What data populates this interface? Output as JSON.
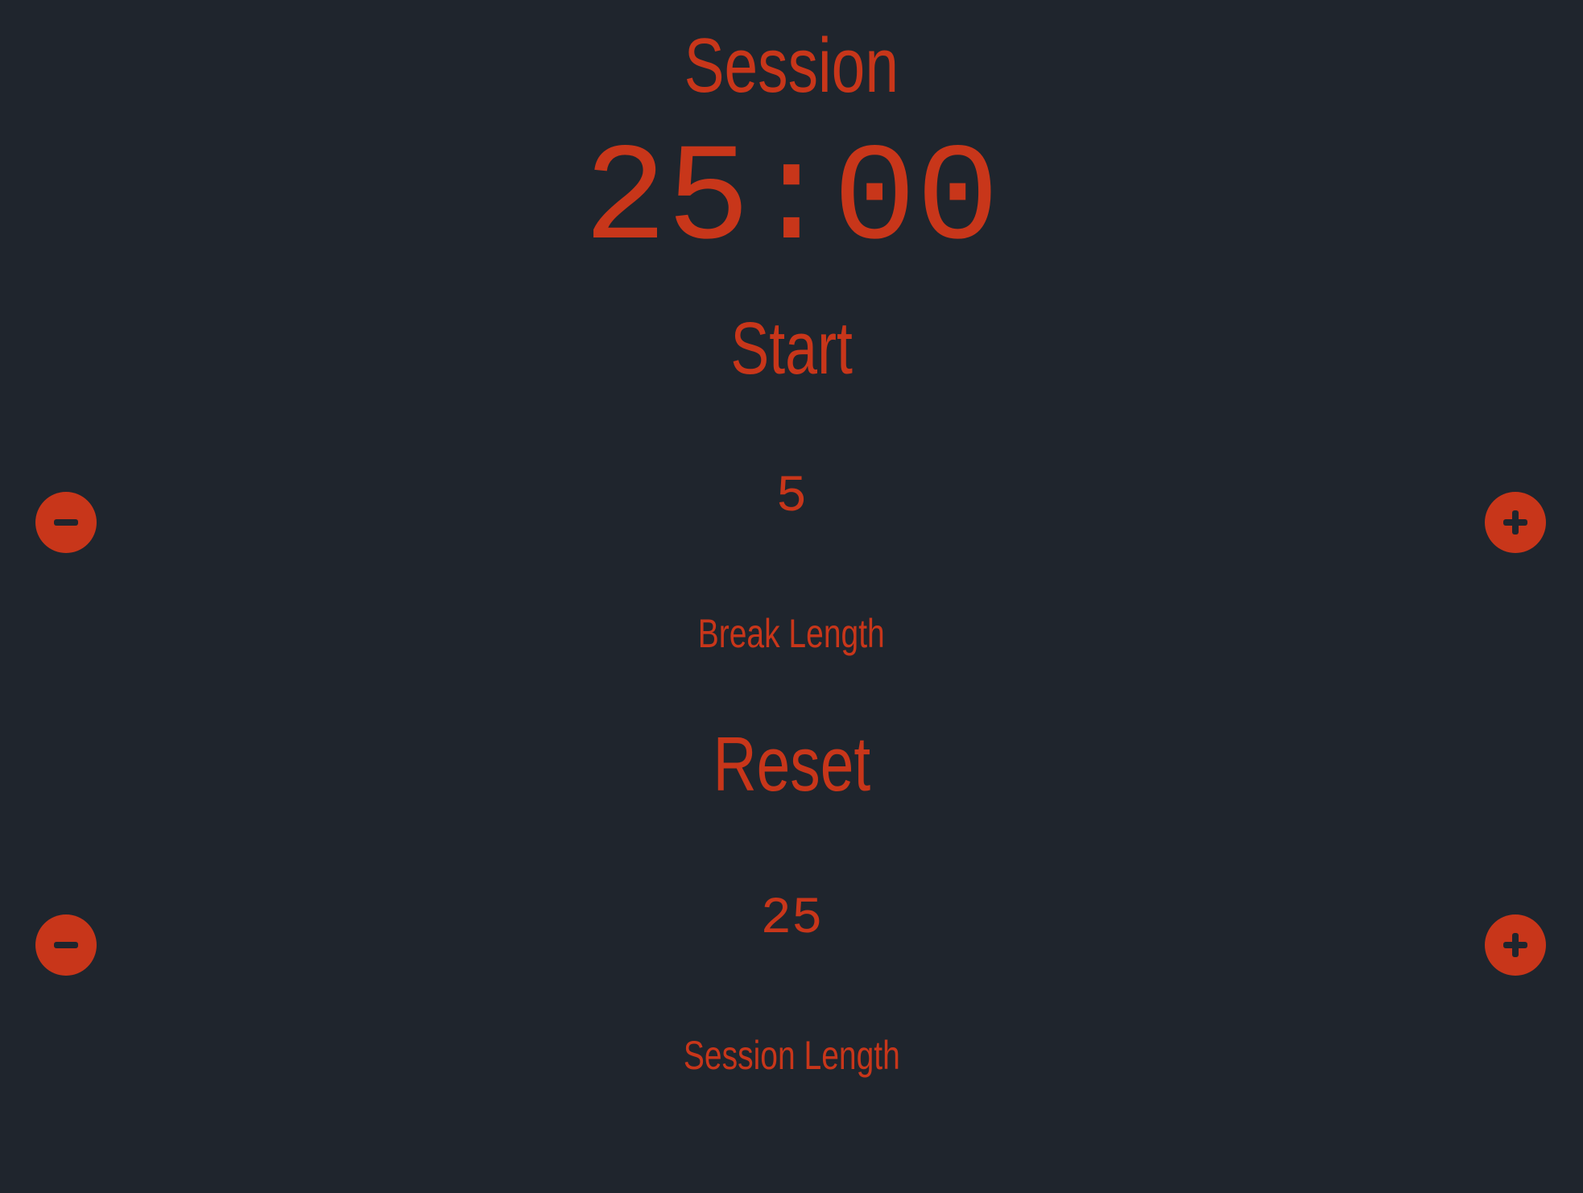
{
  "timer": {
    "mode_label": "Session",
    "display": "25:00"
  },
  "controls": {
    "start_label": "Start",
    "reset_label": "Reset"
  },
  "break": {
    "value": "5",
    "label": "Break Length"
  },
  "session": {
    "value": "25",
    "label": "Session Length"
  },
  "icons": {
    "decrement": "minus-circle-icon",
    "increment": "plus-circle-icon"
  },
  "colors": {
    "background": "#1f252d",
    "accent": "#c8361a"
  }
}
